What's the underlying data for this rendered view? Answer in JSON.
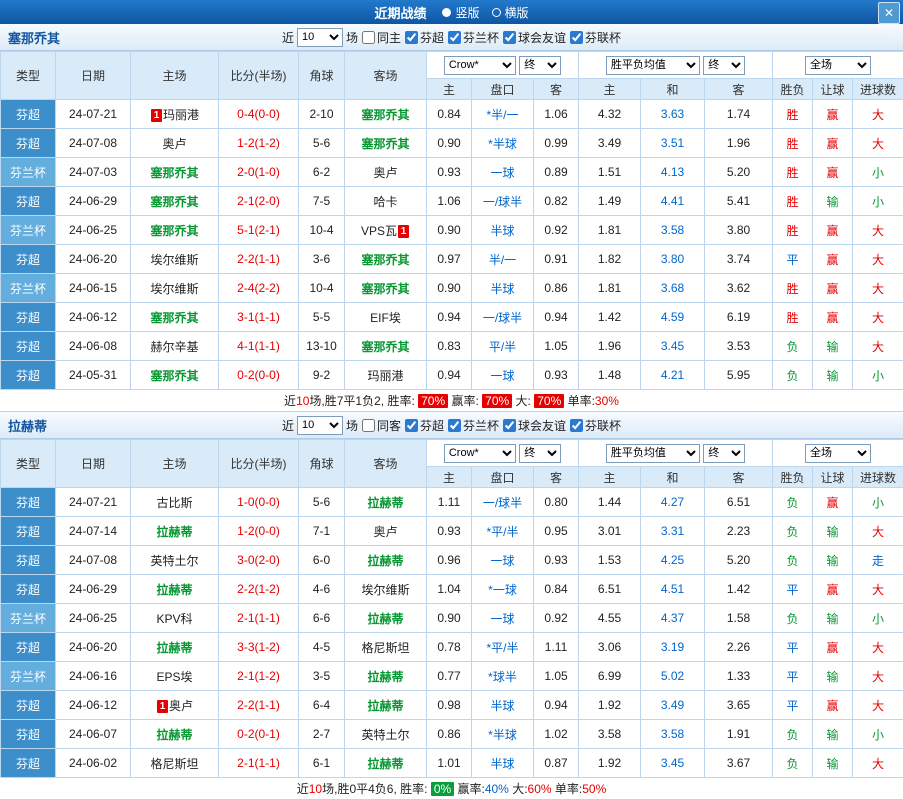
{
  "topbar": {
    "title": "近期战绩",
    "radio_vertical": "竖版",
    "radio_horizontal": "横版",
    "close_icon": "✕"
  },
  "filters": {
    "near_label": "近",
    "games_count": "10",
    "games_suffix": "场",
    "leagues": [
      "芬超",
      "芬兰杯",
      "球会友谊",
      "芬联杯"
    ]
  },
  "header": {
    "cols": [
      "类型",
      "日期",
      "主场",
      "比分(半场)",
      "角球",
      "客场"
    ],
    "odds_company": "Crow*",
    "odds_time": "终",
    "europe_company": "胜平负均值",
    "europe_time": "终",
    "scope": "全场",
    "sub": [
      "主",
      "盘口",
      "客",
      "主",
      "和",
      "客",
      "胜负",
      "让球",
      "进球数"
    ]
  },
  "colors": {
    "win": "#e60000",
    "draw": "#0066cc",
    "lose": "#089733",
    "league_super": "#3d8fcc",
    "league_cup": "#64aede"
  },
  "sections": [
    {
      "team": "塞那乔其",
      "same_side_label": "同主",
      "rows": [
        {
          "type": "芬超",
          "date": "24-07-21",
          "home": "玛丽港",
          "home_badge": "1",
          "home_badge_pos": "before",
          "home_self": false,
          "score": "0-4(0-0)",
          "corners": "2-10",
          "away": "塞那乔其",
          "away_self": true,
          "ah_home": "0.84",
          "handicap": "*半/一",
          "ah_away": "1.06",
          "eu_home": "4.32",
          "eu_draw": "3.63",
          "eu_away": "1.74",
          "result": "胜",
          "ah_result": "赢",
          "goals_result": "大"
        },
        {
          "type": "芬超",
          "date": "24-07-08",
          "home": "奥卢",
          "home_self": false,
          "score": "1-2(1-2)",
          "corners": "5-6",
          "away": "塞那乔其",
          "away_self": true,
          "ah_home": "0.90",
          "handicap": "*半球",
          "ah_away": "0.99",
          "eu_home": "3.49",
          "eu_draw": "3.51",
          "eu_away": "1.96",
          "result": "胜",
          "ah_result": "赢",
          "goals_result": "大"
        },
        {
          "type": "芬兰杯",
          "date": "24-07-03",
          "home": "塞那乔其",
          "home_self": true,
          "score": "2-0(1-0)",
          "corners": "6-2",
          "away": "奥卢",
          "away_self": false,
          "ah_home": "0.93",
          "handicap": "一球",
          "ah_away": "0.89",
          "eu_home": "1.51",
          "eu_draw": "4.13",
          "eu_away": "5.20",
          "result": "胜",
          "ah_result": "赢",
          "goals_result": "小"
        },
        {
          "type": "芬超",
          "date": "24-06-29",
          "home": "塞那乔其",
          "home_self": true,
          "score": "2-1(2-0)",
          "corners": "7-5",
          "away": "哈卡",
          "away_self": false,
          "ah_home": "1.06",
          "handicap": "一/球半",
          "ah_away": "0.82",
          "eu_home": "1.49",
          "eu_draw": "4.41",
          "eu_away": "5.41",
          "result": "胜",
          "ah_result": "输",
          "goals_result": "小"
        },
        {
          "type": "芬兰杯",
          "date": "24-06-25",
          "home": "塞那乔其",
          "home_self": true,
          "score": "5-1(2-1)",
          "corners": "10-4",
          "away": "VPS瓦",
          "away_badge": "1",
          "away_badge_pos": "after",
          "away_self": false,
          "ah_home": "0.90",
          "handicap": "半球",
          "ah_away": "0.92",
          "eu_home": "1.81",
          "eu_draw": "3.58",
          "eu_away": "3.80",
          "result": "胜",
          "ah_result": "赢",
          "goals_result": "大"
        },
        {
          "type": "芬超",
          "date": "24-06-20",
          "home": "埃尔维斯",
          "home_self": false,
          "score": "2-2(1-1)",
          "corners": "3-6",
          "away": "塞那乔其",
          "away_self": true,
          "ah_home": "0.97",
          "handicap": "半/一",
          "ah_away": "0.91",
          "eu_home": "1.82",
          "eu_draw": "3.80",
          "eu_away": "3.74",
          "result": "平",
          "ah_result": "赢",
          "goals_result": "大"
        },
        {
          "type": "芬兰杯",
          "date": "24-06-15",
          "home": "埃尔维斯",
          "home_self": false,
          "score": "2-4(2-2)",
          "corners": "10-4",
          "away": "塞那乔其",
          "away_self": true,
          "ah_home": "0.90",
          "handicap": "半球",
          "ah_away": "0.86",
          "eu_home": "1.81",
          "eu_draw": "3.68",
          "eu_away": "3.62",
          "result": "胜",
          "ah_result": "赢",
          "goals_result": "大"
        },
        {
          "type": "芬超",
          "date": "24-06-12",
          "home": "塞那乔其",
          "home_self": true,
          "score": "3-1(1-1)",
          "corners": "5-5",
          "away": "EIF埃",
          "away_self": false,
          "ah_home": "0.94",
          "handicap": "一/球半",
          "ah_away": "0.94",
          "eu_home": "1.42",
          "eu_draw": "4.59",
          "eu_away": "6.19",
          "result": "胜",
          "ah_result": "赢",
          "goals_result": "大"
        },
        {
          "type": "芬超",
          "date": "24-06-08",
          "home": "赫尔辛基",
          "home_self": false,
          "score": "4-1(1-1)",
          "corners": "13-10",
          "away": "塞那乔其",
          "away_self": true,
          "ah_home": "0.83",
          "handicap": "平/半",
          "ah_away": "1.05",
          "eu_home": "1.96",
          "eu_draw": "3.45",
          "eu_away": "3.53",
          "result": "负",
          "ah_result": "输",
          "goals_result": "大"
        },
        {
          "type": "芬超",
          "date": "24-05-31",
          "home": "塞那乔其",
          "home_self": true,
          "score": "0-2(0-0)",
          "corners": "9-2",
          "away": "玛丽港",
          "away_self": false,
          "ah_home": "0.94",
          "handicap": "一球",
          "ah_away": "0.93",
          "eu_home": "1.48",
          "eu_draw": "4.21",
          "eu_away": "5.95",
          "result": "负",
          "ah_result": "输",
          "goals_result": "小"
        }
      ],
      "summary": [
        {
          "text": "近",
          "style": ""
        },
        {
          "text": "10",
          "style": "t-red"
        },
        {
          "text": "场,胜7平1负2, 胜率: ",
          "style": ""
        },
        {
          "text": "70%",
          "style": "b-red"
        },
        {
          "text": " 赢率: ",
          "style": ""
        },
        {
          "text": "70%",
          "style": "b-red"
        },
        {
          "text": " 大: ",
          "style": ""
        },
        {
          "text": "70%",
          "style": "b-red"
        },
        {
          "text": " 单率:",
          "style": ""
        },
        {
          "text": "30%",
          "style": "t-red"
        }
      ]
    },
    {
      "team": "拉赫蒂",
      "same_side_label": "同客",
      "rows": [
        {
          "type": "芬超",
          "date": "24-07-21",
          "home": "古比斯",
          "home_self": false,
          "score": "1-0(0-0)",
          "corners": "5-6",
          "away": "拉赫蒂",
          "away_self": true,
          "ah_home": "1.11",
          "handicap": "一/球半",
          "ah_away": "0.80",
          "eu_home": "1.44",
          "eu_draw": "4.27",
          "eu_away": "6.51",
          "result": "负",
          "ah_result": "赢",
          "goals_result": "小"
        },
        {
          "type": "芬超",
          "date": "24-07-14",
          "home": "拉赫蒂",
          "home_self": true,
          "score": "1-2(0-0)",
          "corners": "7-1",
          "away": "奥卢",
          "away_self": false,
          "ah_home": "0.93",
          "handicap": "*平/半",
          "ah_away": "0.95",
          "eu_home": "3.01",
          "eu_draw": "3.31",
          "eu_away": "2.23",
          "result": "负",
          "ah_result": "输",
          "goals_result": "大"
        },
        {
          "type": "芬超",
          "date": "24-07-08",
          "home": "英特土尔",
          "home_self": false,
          "score": "3-0(2-0)",
          "corners": "6-0",
          "away": "拉赫蒂",
          "away_self": true,
          "ah_home": "0.96",
          "handicap": "一球",
          "ah_away": "0.93",
          "eu_home": "1.53",
          "eu_draw": "4.25",
          "eu_away": "5.20",
          "result": "负",
          "ah_result": "输",
          "goals_result": "走"
        },
        {
          "type": "芬超",
          "date": "24-06-29",
          "home": "拉赫蒂",
          "home_self": true,
          "score": "2-2(1-2)",
          "corners": "4-6",
          "away": "埃尔维斯",
          "away_self": false,
          "ah_home": "1.04",
          "handicap": "*一球",
          "ah_away": "0.84",
          "eu_home": "6.51",
          "eu_draw": "4.51",
          "eu_away": "1.42",
          "result": "平",
          "ah_result": "赢",
          "goals_result": "大"
        },
        {
          "type": "芬兰杯",
          "date": "24-06-25",
          "home": "KPV科",
          "home_self": false,
          "score": "2-1(1-1)",
          "corners": "6-6",
          "away": "拉赫蒂",
          "away_self": true,
          "ah_home": "0.90",
          "handicap": "一球",
          "ah_away": "0.92",
          "eu_home": "4.55",
          "eu_draw": "4.37",
          "eu_away": "1.58",
          "result": "负",
          "ah_result": "输",
          "goals_result": "小"
        },
        {
          "type": "芬超",
          "date": "24-06-20",
          "home": "拉赫蒂",
          "home_self": true,
          "score": "3-3(1-2)",
          "corners": "4-5",
          "away": "格尼斯坦",
          "away_self": false,
          "ah_home": "0.78",
          "handicap": "*平/半",
          "ah_away": "1.11",
          "eu_home": "3.06",
          "eu_draw": "3.19",
          "eu_away": "2.26",
          "result": "平",
          "ah_result": "赢",
          "goals_result": "大"
        },
        {
          "type": "芬兰杯",
          "date": "24-06-16",
          "home": "EPS埃",
          "home_self": false,
          "score": "2-1(1-2)",
          "corners": "3-5",
          "away": "拉赫蒂",
          "away_self": true,
          "ah_home": "0.77",
          "handicap": "*球半",
          "ah_away": "1.05",
          "eu_home": "6.99",
          "eu_draw": "5.02",
          "eu_away": "1.33",
          "result": "平",
          "ah_result": "输",
          "goals_result": "大"
        },
        {
          "type": "芬超",
          "date": "24-06-12",
          "home": "奥卢",
          "home_badge": "1",
          "home_badge_pos": "before",
          "home_self": false,
          "score": "2-2(1-1)",
          "corners": "6-4",
          "away": "拉赫蒂",
          "away_self": true,
          "ah_home": "0.98",
          "handicap": "半球",
          "ah_away": "0.94",
          "eu_home": "1.92",
          "eu_draw": "3.49",
          "eu_away": "3.65",
          "result": "平",
          "ah_result": "赢",
          "goals_result": "大"
        },
        {
          "type": "芬超",
          "date": "24-06-07",
          "home": "拉赫蒂",
          "home_self": true,
          "score": "0-2(0-1)",
          "corners": "2-7",
          "away": "英特土尔",
          "away_self": false,
          "ah_home": "0.86",
          "handicap": "*半球",
          "ah_away": "1.02",
          "eu_home": "3.58",
          "eu_draw": "3.58",
          "eu_away": "1.91",
          "result": "负",
          "ah_result": "输",
          "goals_result": "小"
        },
        {
          "type": "芬超",
          "date": "24-06-02",
          "home": "格尼斯坦",
          "home_self": false,
          "score": "2-1(1-1)",
          "corners": "6-1",
          "away": "拉赫蒂",
          "away_self": true,
          "ah_home": "1.01",
          "handicap": "半球",
          "ah_away": "0.87",
          "eu_home": "1.92",
          "eu_draw": "3.45",
          "eu_away": "3.67",
          "result": "负",
          "ah_result": "输",
          "goals_result": "大"
        }
      ],
      "summary": [
        {
          "text": "近",
          "style": ""
        },
        {
          "text": "10",
          "style": "t-red"
        },
        {
          "text": "场,胜0平4负6, 胜率: ",
          "style": ""
        },
        {
          "text": "0%",
          "style": "b-green"
        },
        {
          "text": " 赢率:",
          "style": ""
        },
        {
          "text": "40%",
          "style": "t-blue"
        },
        {
          "text": " 大:",
          "style": ""
        },
        {
          "text": "60%",
          "style": "t-red"
        },
        {
          "text": " 单率:",
          "style": ""
        },
        {
          "text": "50%",
          "style": "t-red"
        }
      ]
    }
  ]
}
